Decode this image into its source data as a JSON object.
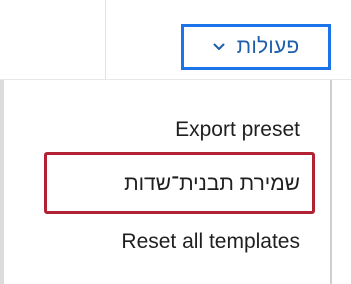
{
  "toolbar": {
    "actions_label": "פעולות",
    "actions_icon": "chevron-down-icon",
    "accent_color": "#1a73e8"
  },
  "menu": {
    "items": [
      {
        "label": "Export preset"
      },
      {
        "label": "שמירת תבנית־שדות"
      },
      {
        "label": "Reset all templates"
      }
    ],
    "highlight_color": "#b22234"
  }
}
